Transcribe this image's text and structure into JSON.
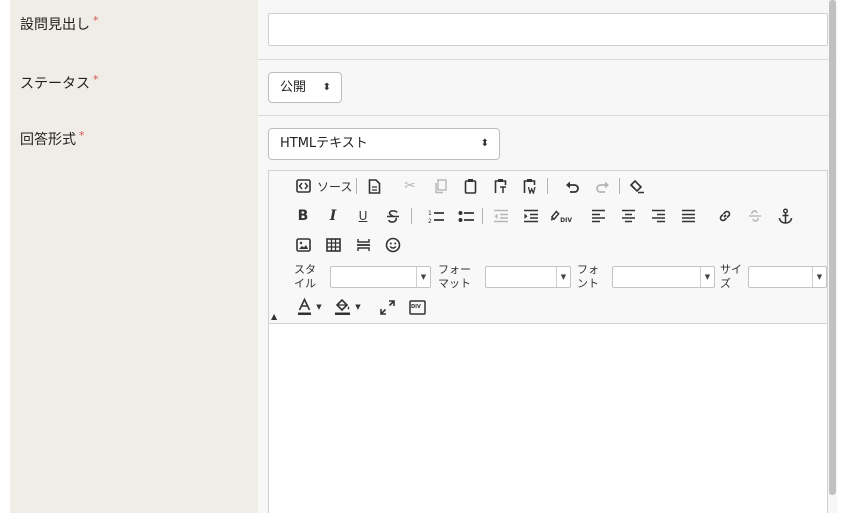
{
  "form": {
    "fields": [
      {
        "label": "設問見出し",
        "required": "*"
      },
      {
        "label": "ステータス",
        "required": "*"
      },
      {
        "label": "回答形式",
        "required": "*"
      }
    ],
    "status_select": {
      "value": "公開",
      "arrow": "⬍"
    },
    "format_select": {
      "value": "HTMLテキスト",
      "arrow": "⬍"
    }
  },
  "editor": {
    "source_label": "ソース",
    "style_label": "スタ\nイル",
    "format_label": "フォー\nマット",
    "font_label": "フォ\nント",
    "size_label": "サイ\nズ",
    "div_tag": "DIV",
    "collapse_glyph": "▲",
    "combo_arrow": "▼"
  }
}
